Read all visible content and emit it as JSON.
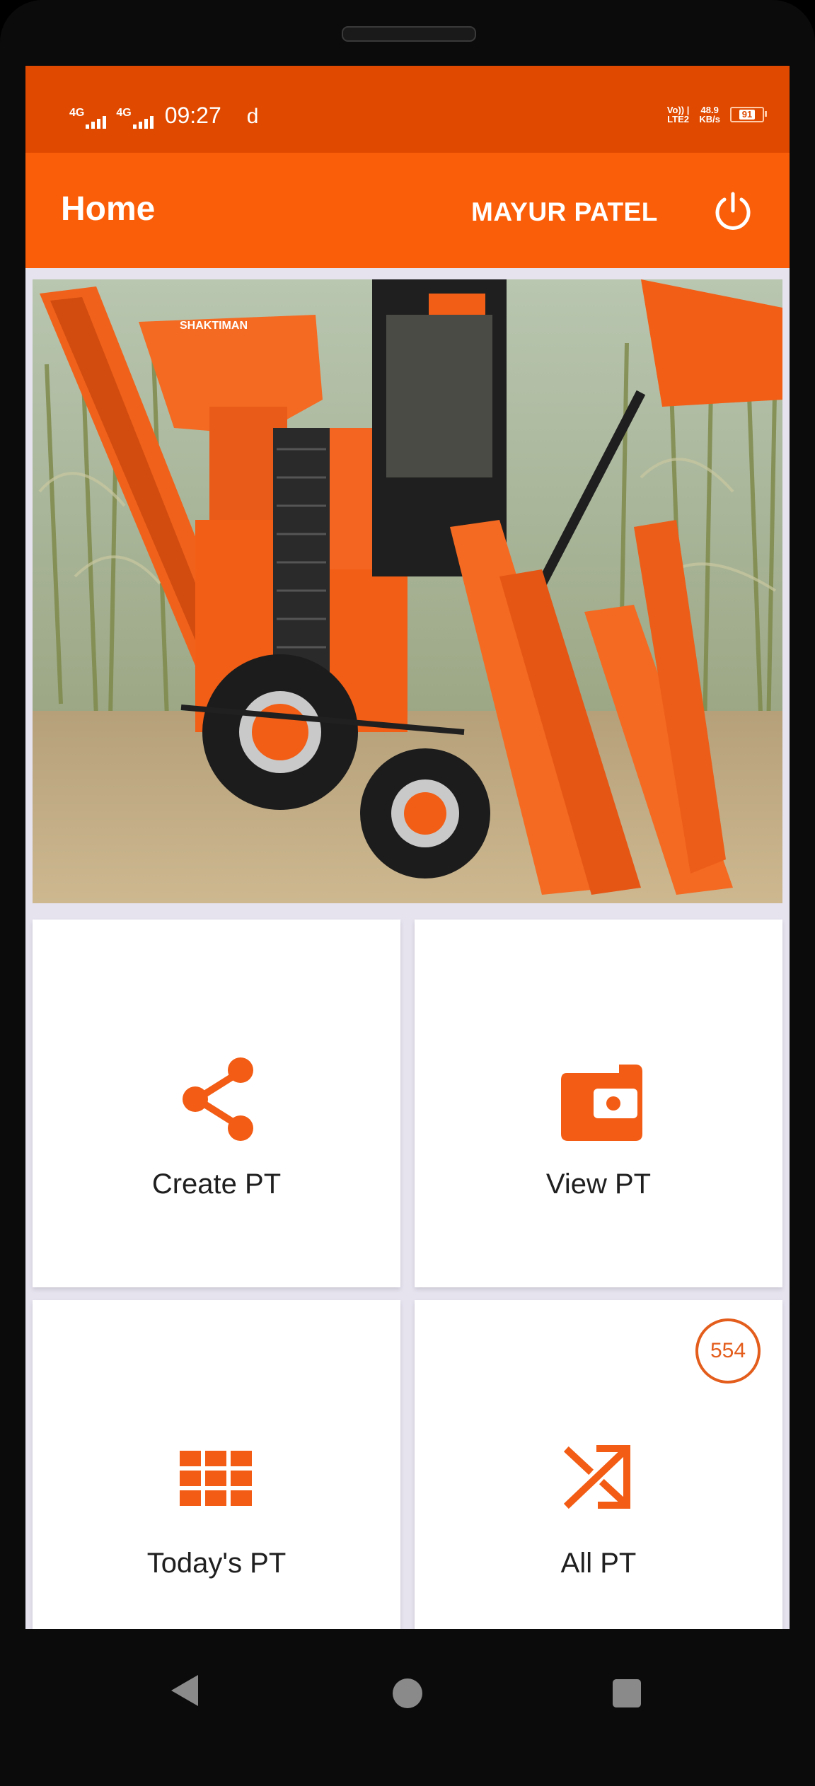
{
  "status_bar": {
    "network_1": "4G",
    "network_2": "4G",
    "time": "09:27",
    "notification_glyph": "d",
    "volte_line1": "Vo)) |",
    "volte_line2": "LTE2",
    "speed_value": "48.9",
    "speed_unit": "KB/s",
    "battery": "91"
  },
  "app_bar": {
    "title": "Home",
    "user_name": "MAYUR PATEL",
    "power_icon": "power-icon"
  },
  "banner": {
    "subject": "orange sugarcane harvester in a cane field",
    "brand_text": "SHAKTIMAN"
  },
  "tiles": [
    {
      "label": "Create PT",
      "icon": "share-icon"
    },
    {
      "label": "View PT",
      "icon": "wallet-icon"
    },
    {
      "label": "Today's PT",
      "icon": "grid-icon"
    },
    {
      "label": "All PT",
      "icon": "shuffle-icon",
      "badge": "554"
    }
  ],
  "nav_bar": {
    "back_icon": "back-triangle-icon",
    "home_icon": "home-circle-icon",
    "recents_icon": "recents-square-icon"
  },
  "colors": {
    "status_bar": "#e04a00",
    "app_bar": "#fb5e09",
    "accent": "#f25c14",
    "screen_bg": "#e6e3ef",
    "tile_bg": "#ffffff"
  }
}
